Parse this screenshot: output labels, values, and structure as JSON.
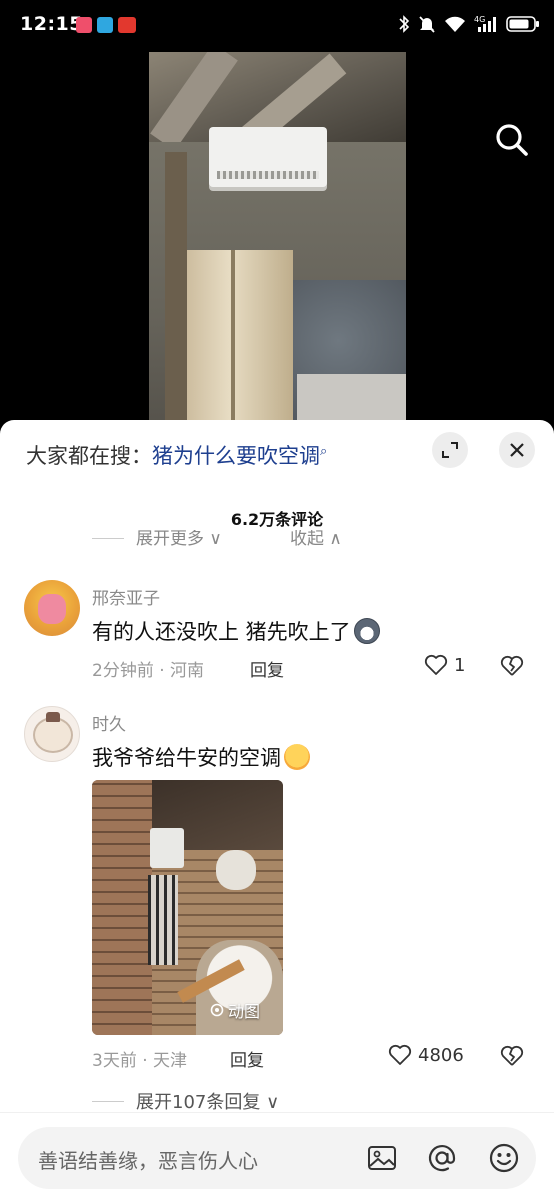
{
  "status_bar": {
    "time": "12:15",
    "notification_icons": [
      "app-notification-icon",
      "telegram-icon",
      "news-app-icon"
    ],
    "system_icons": [
      "bluetooth-icon",
      "mute-icon",
      "wifi-icon",
      "signal-4g-icon",
      "battery-icon"
    ]
  },
  "video": {
    "search_icon": "search-icon"
  },
  "comments_sheet": {
    "trending_prefix": "大家都在搜：",
    "trending_keyword": "猪为什么要吹空调",
    "comment_count": "6.2万条评论",
    "expand_more": "展开更多",
    "collapse": "收起",
    "comments": [
      {
        "name": "邢奈亚子",
        "text": "有的人还没吹上 猪先吹上了",
        "emoji": "husky-emoji",
        "meta": "2分钟前 · 河南",
        "reply": "回复",
        "likes": "1"
      },
      {
        "name": "时久",
        "text": "我爷爷给牛安的空调",
        "emoji": "hugging-face-emoji",
        "image_badge": "动图",
        "meta": "3天前 · 天津",
        "reply": "回复",
        "likes": "4806",
        "more_replies": "展开107条回复"
      }
    ]
  },
  "input_bar": {
    "placeholder": "善语结善缘，恶言伤人心",
    "icons": [
      "image-icon",
      "at-mention-icon",
      "emoji-icon"
    ]
  },
  "colors": {
    "keyword": "#1e3f8f",
    "meta_gray": "#999999",
    "background_dark": "#000000",
    "sheet_bg": "#ffffff"
  }
}
